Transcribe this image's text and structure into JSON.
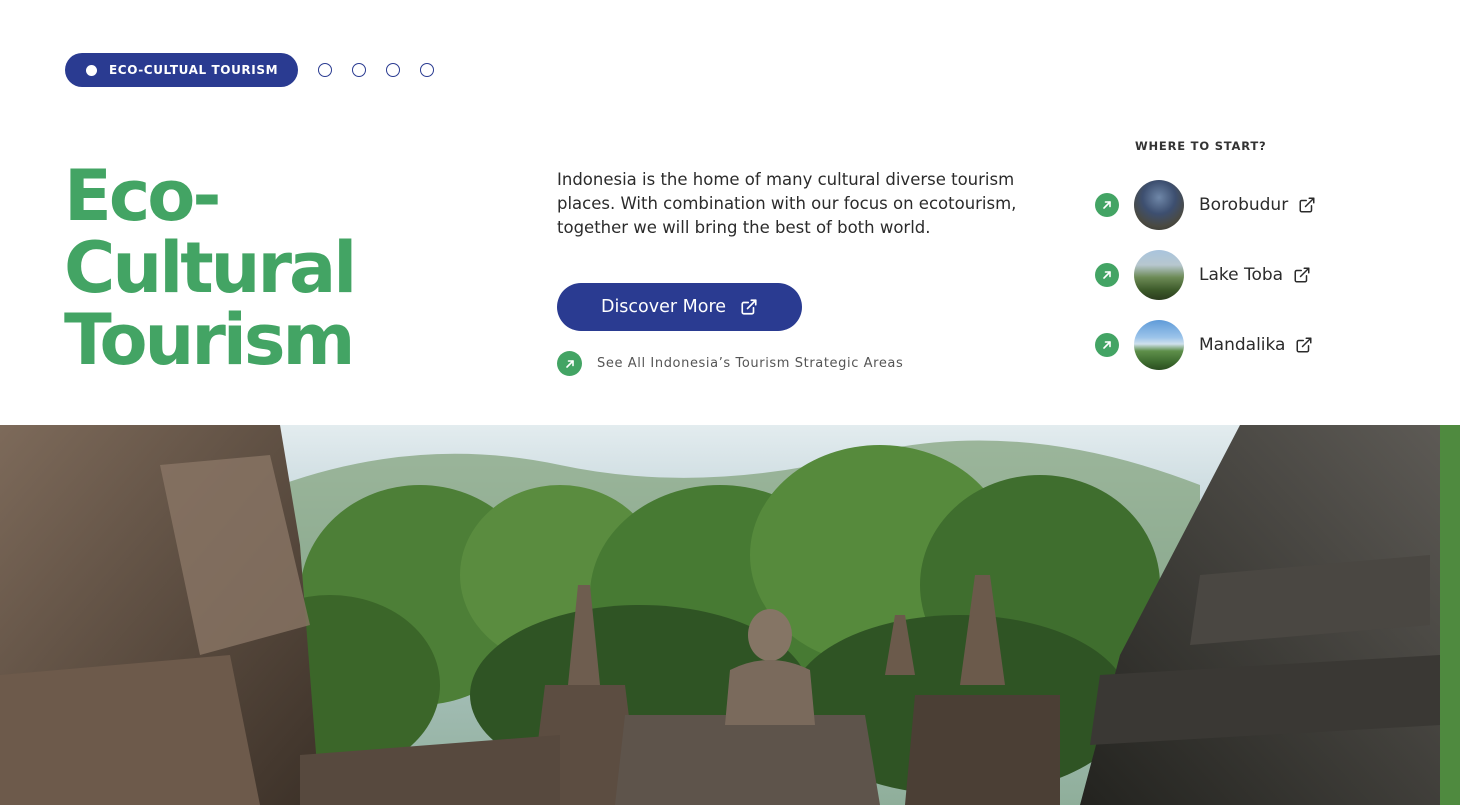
{
  "tabs": {
    "active_label": "ECO-CULTUAL TOURISM",
    "inactive_count": 4
  },
  "hero_title": "Eco-Cultural Tourism",
  "description": "Indonesia is the home of many cultural diverse tourism places. With  combination with our focus on ecotourism, together we will bring the best of both world.",
  "discover_button": "Discover More",
  "see_all_link": "See All Indonesia’s Tourism Strategic Areas",
  "where_to_start": {
    "title": "WHERE TO START?",
    "destinations": [
      {
        "name": "Borobudur"
      },
      {
        "name": "Lake Toba"
      },
      {
        "name": "Mandalika"
      }
    ]
  },
  "colors": {
    "brand_blue": "#2a3b91",
    "brand_green": "#43a464"
  },
  "icons": {
    "external_link": "external-link-icon",
    "arrow_up_right": "arrow-up-right-icon"
  }
}
